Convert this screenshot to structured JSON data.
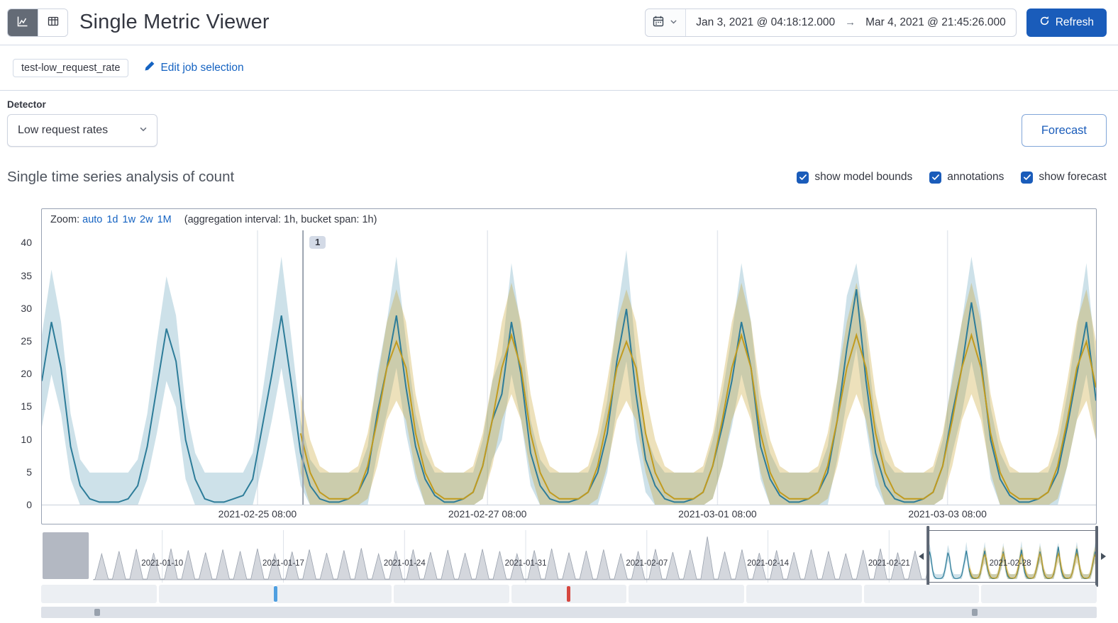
{
  "header": {
    "title": "Single Metric Viewer",
    "refresh_label": "Refresh",
    "time_range": {
      "start": "Jan 3, 2021 @ 04:18:12.000",
      "arrow": "→",
      "end": "Mar 4, 2021 @ 21:45:26.000"
    }
  },
  "job_bar": {
    "job_badge": "test-low_request_rate",
    "edit_link": "Edit job selection"
  },
  "detector": {
    "label": "Detector",
    "selected": "Low request rates"
  },
  "forecast_button": "Forecast",
  "series_section": {
    "heading": "Single time series analysis of count",
    "checkboxes": [
      {
        "label": "show model bounds",
        "checked": true
      },
      {
        "label": "annotations",
        "checked": true
      },
      {
        "label": "show forecast",
        "checked": true
      }
    ]
  },
  "zoom_bar": {
    "prefix": "Zoom:",
    "links": [
      "auto",
      "1d",
      "1w",
      "2w",
      "1M"
    ],
    "suffix": "(aggregation interval: 1h, bucket span: 1h)"
  },
  "colors": {
    "primary": "#1a5cba",
    "link": "#1563c2",
    "text": "#343741",
    "subdued": "#69707d",
    "border": "#d3dae6",
    "actual": "#2d7c99",
    "model_band": "rgba(77,149,177,0.28)",
    "forecast": "#c19b1f",
    "forecast_band": "rgba(198,162,43,0.32)",
    "annotation_blue": "#4f9fe0",
    "annotation_red": "#d6473f",
    "context_fill": "rgba(160,167,179,0.45)",
    "context_stroke": "#9aa2ae"
  },
  "chart_data": {
    "type": "line",
    "title": "Single time series analysis of count",
    "main": {
      "ylim": [
        0,
        42
      ],
      "yticks": [
        0,
        5,
        10,
        15,
        20,
        25,
        30,
        35,
        40
      ],
      "x_hours": 220,
      "t_step": 2,
      "forecast_t0": 54,
      "xticks": [
        {
          "hour": 45,
          "label": "2021-02-25 08:00"
        },
        {
          "hour": 93,
          "label": "2021-02-27 08:00"
        },
        {
          "hour": 141,
          "label": "2021-03-01 08:00"
        },
        {
          "hour": 189,
          "label": "2021-03-03 08:00"
        }
      ],
      "annotation": {
        "hour": 54.5,
        "label": "1"
      },
      "series": [
        {
          "name": "actual",
          "values": [
            19,
            28,
            21,
            9,
            3,
            1,
            0.5,
            0.5,
            0.5,
            1,
            3,
            9,
            18,
            27,
            22,
            10,
            4,
            1,
            0.5,
            0.5,
            1,
            1.5,
            4,
            12,
            20,
            29,
            19,
            8,
            3,
            1,
            0.5,
            0.5,
            1,
            2,
            5,
            14,
            21,
            29,
            18,
            9,
            4,
            1.5,
            0.5,
            0.5,
            1,
            2,
            6,
            13,
            17,
            28,
            20,
            8,
            3,
            1,
            0.5,
            0.5,
            1,
            2,
            5,
            11,
            22,
            30,
            17,
            7,
            3,
            1,
            0.5,
            0.5,
            1,
            2,
            6,
            12,
            19,
            28,
            21,
            9,
            4,
            1.5,
            0.5,
            0.5,
            1,
            2,
            5,
            13,
            24,
            33,
            19,
            8,
            3,
            1,
            0.5,
            0.5,
            1,
            2,
            6,
            14,
            21,
            31,
            22,
            10,
            4,
            1.5,
            0.5,
            0.5,
            1,
            2,
            5,
            12,
            20,
            28,
            16
          ]
        },
        {
          "name": "model_upper",
          "values": [
            26,
            36,
            28,
            14,
            7,
            5,
            5,
            5,
            5,
            5,
            7,
            14,
            25,
            35,
            29,
            15,
            8,
            5,
            5,
            5,
            5,
            5,
            8,
            17,
            27,
            38,
            26,
            13,
            7,
            5,
            5,
            5,
            5,
            5,
            9,
            20,
            28,
            38,
            25,
            14,
            8,
            5,
            5,
            5,
            5,
            5,
            10,
            19,
            23,
            37,
            27,
            13,
            7,
            5,
            5,
            5,
            5,
            5,
            9,
            16,
            29,
            39,
            23,
            11,
            7,
            5,
            5,
            5,
            5,
            5,
            10,
            17,
            26,
            37,
            28,
            14,
            8,
            5,
            5,
            5,
            5,
            5,
            9,
            19,
            32,
            37,
            26,
            13,
            7,
            5,
            5,
            5,
            5,
            5,
            10,
            20,
            28,
            38,
            29,
            15,
            8,
            5,
            5,
            5,
            5,
            5,
            9,
            17,
            27,
            37,
            22
          ]
        },
        {
          "name": "model_lower",
          "values": [
            12,
            20,
            14,
            4,
            0,
            0,
            0,
            0,
            0,
            0,
            0,
            4,
            11,
            19,
            15,
            4,
            0,
            0,
            0,
            0,
            0,
            0,
            0,
            6,
            13,
            21,
            12,
            3,
            0,
            0,
            0,
            0,
            0,
            0,
            0,
            8,
            14,
            21,
            11,
            4,
            0,
            0,
            0,
            0,
            0,
            0,
            1,
            7,
            10,
            20,
            13,
            3,
            0,
            0,
            0,
            0,
            0,
            0,
            0,
            5,
            15,
            22,
            10,
            2,
            0,
            0,
            0,
            0,
            0,
            0,
            1,
            6,
            12,
            20,
            14,
            4,
            0,
            0,
            0,
            0,
            0,
            0,
            0,
            7,
            16,
            24,
            12,
            3,
            0,
            0,
            0,
            0,
            0,
            0,
            1,
            8,
            14,
            22,
            15,
            4,
            0,
            0,
            0,
            0,
            0,
            0,
            0,
            6,
            13,
            20,
            10
          ]
        },
        {
          "name": "forecast",
          "values": [
            11,
            5,
            2,
            1,
            1,
            1,
            2,
            6,
            13,
            21,
            25,
            21,
            11,
            5,
            2,
            1,
            1,
            1,
            2,
            6,
            13,
            21,
            26,
            21,
            11,
            5,
            2,
            1,
            1,
            1,
            2,
            6,
            13,
            21,
            25,
            21,
            11,
            5,
            2,
            1,
            1,
            1,
            2,
            6,
            13,
            21,
            26,
            21,
            11,
            5,
            2,
            1,
            1,
            1,
            2,
            6,
            13,
            21,
            26,
            21,
            11,
            5,
            2,
            1,
            1,
            1,
            2,
            6,
            13,
            21,
            26,
            21,
            11,
            5,
            2,
            1,
            1,
            1,
            2,
            6,
            13,
            21,
            25,
            18
          ]
        },
        {
          "name": "forecast_upper",
          "values": [
            17,
            10,
            6,
            5,
            5,
            5,
            6,
            11,
            19,
            28,
            33,
            28,
            17,
            10,
            6,
            5,
            5,
            5,
            6,
            11,
            19,
            28,
            34,
            28,
            17,
            10,
            6,
            5,
            5,
            5,
            6,
            11,
            19,
            28,
            33,
            28,
            17,
            10,
            6,
            5,
            5,
            5,
            6,
            11,
            19,
            28,
            34,
            28,
            17,
            10,
            6,
            5,
            5,
            5,
            6,
            11,
            19,
            28,
            34,
            28,
            17,
            10,
            6,
            5,
            5,
            5,
            6,
            11,
            19,
            28,
            34,
            28,
            17,
            10,
            6,
            5,
            5,
            5,
            6,
            11,
            19,
            28,
            33,
            25
          ]
        },
        {
          "name": "forecast_lower",
          "values": [
            5,
            0,
            0,
            0,
            0,
            0,
            0,
            1,
            6,
            13,
            16,
            13,
            5,
            0,
            0,
            0,
            0,
            0,
            0,
            1,
            6,
            13,
            17,
            13,
            5,
            0,
            0,
            0,
            0,
            0,
            0,
            1,
            6,
            13,
            16,
            13,
            5,
            0,
            0,
            0,
            0,
            0,
            0,
            1,
            6,
            13,
            17,
            13,
            5,
            0,
            0,
            0,
            0,
            0,
            0,
            1,
            6,
            13,
            17,
            13,
            5,
            0,
            0,
            0,
            0,
            0,
            0,
            1,
            6,
            13,
            17,
            13,
            5,
            0,
            0,
            0,
            0,
            0,
            0,
            1,
            6,
            13,
            16,
            10
          ]
        }
      ]
    },
    "context": {
      "days": 61,
      "labels": [
        {
          "day": 7,
          "label": "2021-01-10"
        },
        {
          "day": 14,
          "label": "2021-01-17"
        },
        {
          "day": 21,
          "label": "2021-01-24"
        },
        {
          "day": 28,
          "label": "2021-01-31"
        },
        {
          "day": 35,
          "label": "2021-02-07"
        },
        {
          "day": 42,
          "label": "2021-02-14"
        },
        {
          "day": 49,
          "label": "2021-02-21"
        },
        {
          "day": 56,
          "label": "2021-02-28"
        }
      ],
      "day_amplitude": [
        0,
        0,
        0,
        0.6,
        0.66,
        0.71,
        0.62,
        0.72,
        0.68,
        0.63,
        0.7,
        0.66,
        0.72,
        0.6,
        0.65,
        0.7,
        0.62,
        0.68,
        0.73,
        0.6,
        0.67,
        0.7,
        0.64,
        0.69,
        0.62,
        0.71,
        0.66,
        0.6,
        0.68,
        0.72,
        0.63,
        0.67,
        0.7,
        0.61,
        0.66,
        0.71,
        0.64,
        0.69,
        1,
        0.65,
        0.7,
        0.62,
        0.68,
        0.64,
        0.7,
        0.66,
        0.61,
        0.69,
        0.72,
        0.63,
        0.67,
        0.7,
        0.65,
        0.68,
        0.62,
        0.7,
        0.66,
        0.71,
        0.64,
        0.68,
        0.65
      ],
      "selection": {
        "start_day": 51.25,
        "end_day": 61
      },
      "annotation_markers": [
        {
          "frac": 0.2204,
          "color": "blue"
        },
        {
          "frac": 0.498,
          "color": "red"
        }
      ],
      "scroll_markers": [
        {
          "frac": 0.0504
        },
        {
          "frac": 0.8817
        }
      ]
    }
  }
}
